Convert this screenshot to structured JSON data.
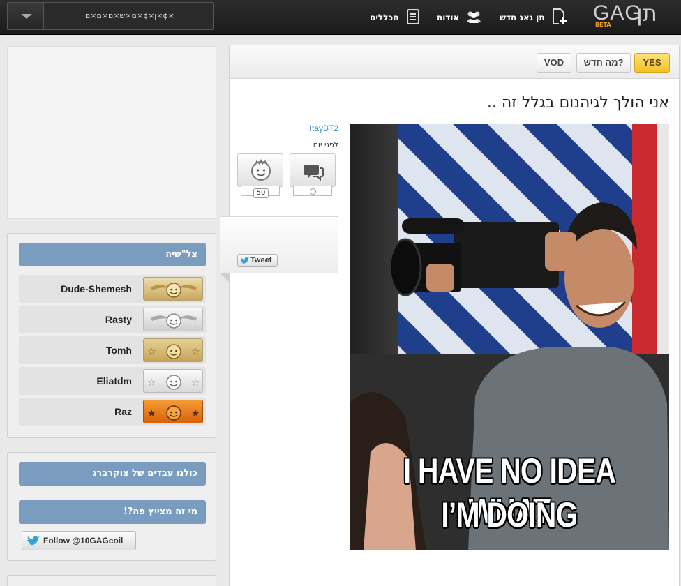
{
  "header": {
    "search_value": "ן×¢×ם×ש×ם×ם×ם×ϕ×",
    "nav": {
      "rules": "הכללים",
      "about": "אודות",
      "submit": "תן גאג חדש"
    },
    "logo": {
      "latin": "GAG",
      "hebrew": "תן",
      "beta": "BETA"
    }
  },
  "tabs": [
    {
      "label": "YES",
      "active": true
    },
    {
      "label": "מה חדש?",
      "active": false
    },
    {
      "label": "VOD",
      "active": false
    }
  ],
  "post": {
    "title": "אני הולך לגיהנום בגלל זה ..",
    "author": "ItayBT2",
    "time": "לפני יום",
    "likes": "50",
    "tweet_label": "Tweet",
    "meme_text": [
      "I HAVE NO IDEA WHAT",
      "I’M DOING"
    ]
  },
  "sidebar": {
    "leaderboard_title": "צל\"שיה",
    "leaderboard": [
      {
        "name": "Dude-Shemesh",
        "medal": "gold-wings"
      },
      {
        "name": "Rasty",
        "medal": "silver-wings"
      },
      {
        "name": "Tomh",
        "medal": "gold-stars"
      },
      {
        "name": "Eliatdm",
        "medal": "silver-stars"
      },
      {
        "name": "Raz",
        "medal": "orange-stars"
      }
    ],
    "widget_title_1": "כולנו עבדים של צוקרברג",
    "widget_title_2": "מי זה מצייץ פה?!",
    "follow_label": "Follow @10GAGcoil"
  },
  "colors": {
    "topbar": "#222222",
    "accent_yellow": "#f2c12a",
    "widget_header": "#7a9dbf",
    "author_link": "#3a8fc1"
  }
}
